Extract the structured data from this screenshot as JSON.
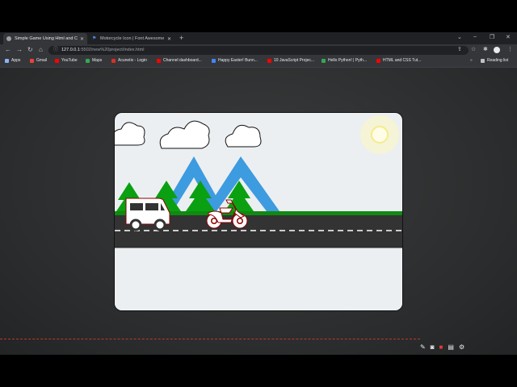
{
  "tabs": [
    {
      "title": "Simple Game Using Html and CSS",
      "active": true
    },
    {
      "title": "Motorcycle Icon | Font Awesome",
      "active": false
    }
  ],
  "toolbar": {
    "url_host": "127.0.0.1",
    "url_path": ":5502/new%20project/index.html"
  },
  "bookmarks": [
    {
      "label": "Apps",
      "color": "#8ab4f8"
    },
    {
      "label": "Gmail",
      "color": "#ea4335"
    },
    {
      "label": "YouTube",
      "color": "#ff0000"
    },
    {
      "label": "Maps",
      "color": "#34a853"
    },
    {
      "label": "Acunetix - Login",
      "color": "#d93025"
    },
    {
      "label": "Channel dashboard...",
      "color": "#ff0000"
    },
    {
      "label": "Happy Easter! Bunn...",
      "color": "#4285f4"
    },
    {
      "label": "10 JavaScript Projec...",
      "color": "#ff0000"
    },
    {
      "label": "Hello Python! | Pyth...",
      "color": "#34a853"
    },
    {
      "label": "HTML and CSS Tut...",
      "color": "#ff0000"
    }
  ],
  "reading_list": "Reading list",
  "game": {
    "sky_color": "#eceff1",
    "mountain_color": "#3d9be0",
    "tree_color": "#0aa012",
    "grass_color": "#108a10",
    "road_color": "#333333",
    "vehicle_color": "#ffffff",
    "vehicle_outline": "#8b0000",
    "sun_color": "#fffde0"
  }
}
